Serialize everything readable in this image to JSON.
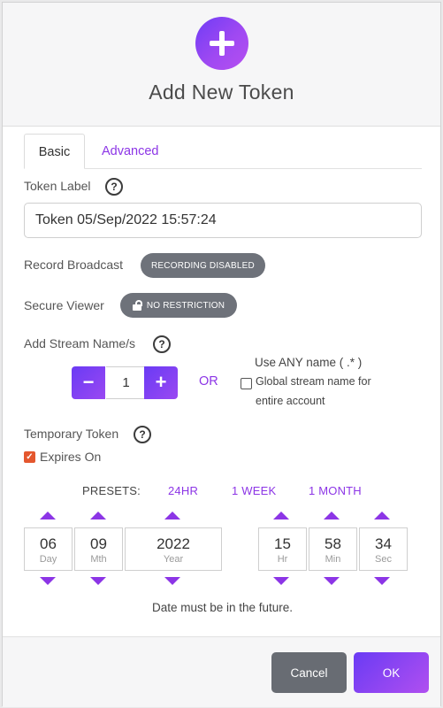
{
  "header": {
    "title": "Add New Token"
  },
  "tabs": [
    {
      "label": "Basic"
    },
    {
      "label": "Advanced"
    }
  ],
  "token_label": {
    "label": "Token Label",
    "value": "Token 05/Sep/2022 15:57:24"
  },
  "record_broadcast": {
    "label": "Record Broadcast",
    "status": "RECORDING DISABLED"
  },
  "secure_viewer": {
    "label": "Secure Viewer",
    "status": "NO RESTRICTION"
  },
  "streams": {
    "label": "Add Stream Name/s",
    "count": "1",
    "or_text": "OR",
    "any_name_label": "Use ANY name ( .* )",
    "global_text_1": "Global stream name for",
    "global_text_2": "entire account",
    "global_checked": false
  },
  "temporary_token": {
    "label": "Temporary Token",
    "expires_label": "Expires On",
    "expires_checked": true,
    "presets_label": "PRESETS:",
    "presets": [
      "24HR",
      "1 WEEK",
      "1 MONTH"
    ],
    "fields": [
      {
        "value": "06",
        "unit": "Day"
      },
      {
        "value": "09",
        "unit": "Mth"
      },
      {
        "value": "2022",
        "unit": "Year"
      },
      {
        "value": "15",
        "unit": "Hr"
      },
      {
        "value": "58",
        "unit": "Min"
      },
      {
        "value": "34",
        "unit": "Sec"
      }
    ],
    "message": "Date must be in the future."
  },
  "help_symbol": "?",
  "footer": {
    "cancel": "Cancel",
    "ok": "OK"
  },
  "colors": {
    "accent": "#8c35e6",
    "gradient_start": "#6a3bf4",
    "pill": "#6e727a",
    "checkbox": "#e4572e"
  }
}
